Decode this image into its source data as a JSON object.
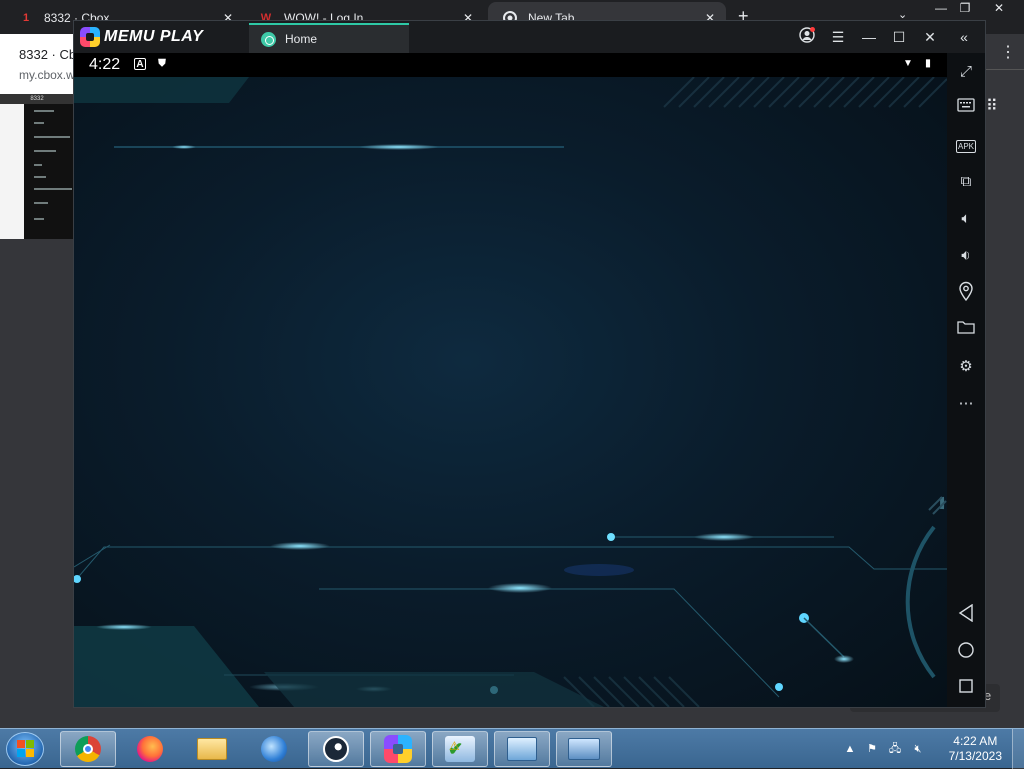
{
  "browser": {
    "tabs": [
      {
        "title": "8332 · Cbox",
        "favicon": "1",
        "favicon_color": "#e53935"
      },
      {
        "title": "WOW! - Log In",
        "favicon": "W",
        "favicon_color": "#d32f2f"
      },
      {
        "title": "New Tab",
        "favicon": "chrome-icon"
      }
    ],
    "new_tab": "+",
    "page_title": "8332 · Cb",
    "page_url": "my.cbox.w",
    "cbox_header": "8332"
  },
  "memu": {
    "logo_text": "MEMU PLAY",
    "tab_label": "Home",
    "status_time": "4:22",
    "accent_color": "#2ec9a6",
    "sidebar_icons": [
      "fullscreen-icon",
      "keyboard-icon",
      "apk-icon",
      "multi-window-icon",
      "volume-up-icon",
      "volume-down-icon",
      "location-icon",
      "folder-icon",
      "settings-icon",
      "more-icon"
    ],
    "apk_label": "APK",
    "nav_icons": [
      "back-icon",
      "home-icon",
      "recents-icon"
    ]
  },
  "taskbar": {
    "time": "4:22 AM",
    "date": "7/13/2023"
  }
}
